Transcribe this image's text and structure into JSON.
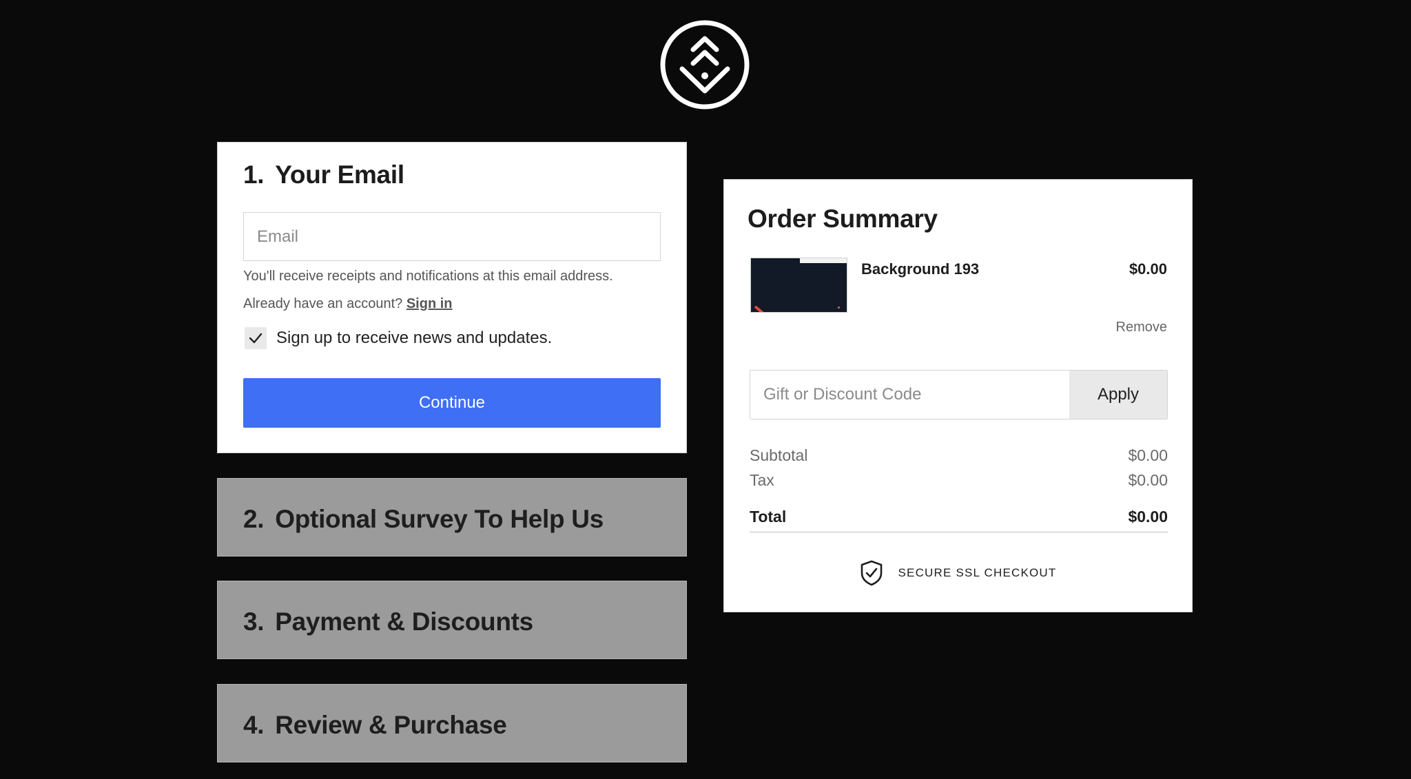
{
  "logo": {
    "icon": "double-chevron-down-circle-logo"
  },
  "steps": [
    {
      "number": "1.",
      "title": "Your Email"
    },
    {
      "number": "2.",
      "title": "Optional Survey To Help Us"
    },
    {
      "number": "3.",
      "title": "Payment & Discounts"
    },
    {
      "number": "4.",
      "title": "Review & Purchase"
    }
  ],
  "email_step": {
    "email_placeholder": "Email",
    "email_value": "",
    "helper_text": "You'll receive receipts and notifications at this email address.",
    "account_prompt": "Already have an account?",
    "signin_label": "Sign in",
    "newsletter_checked": true,
    "newsletter_label": "Sign up to receive news and updates.",
    "continue_label": "Continue"
  },
  "summary": {
    "title": "Order Summary",
    "items": [
      {
        "name": "Background 193",
        "price": "$0.00",
        "remove_label": "Remove"
      }
    ],
    "code_placeholder": "Gift or Discount Code",
    "apply_label": "Apply",
    "subtotal_label": "Subtotal",
    "subtotal_value": "$0.00",
    "tax_label": "Tax",
    "tax_value": "$0.00",
    "total_label": "Total",
    "total_value": "$0.00",
    "secure_text": "SECURE SSL CHECKOUT"
  },
  "colors": {
    "background": "#0a0a0a",
    "primary_button": "#3e6ff4",
    "inactive_step": "#9b9b9b"
  }
}
